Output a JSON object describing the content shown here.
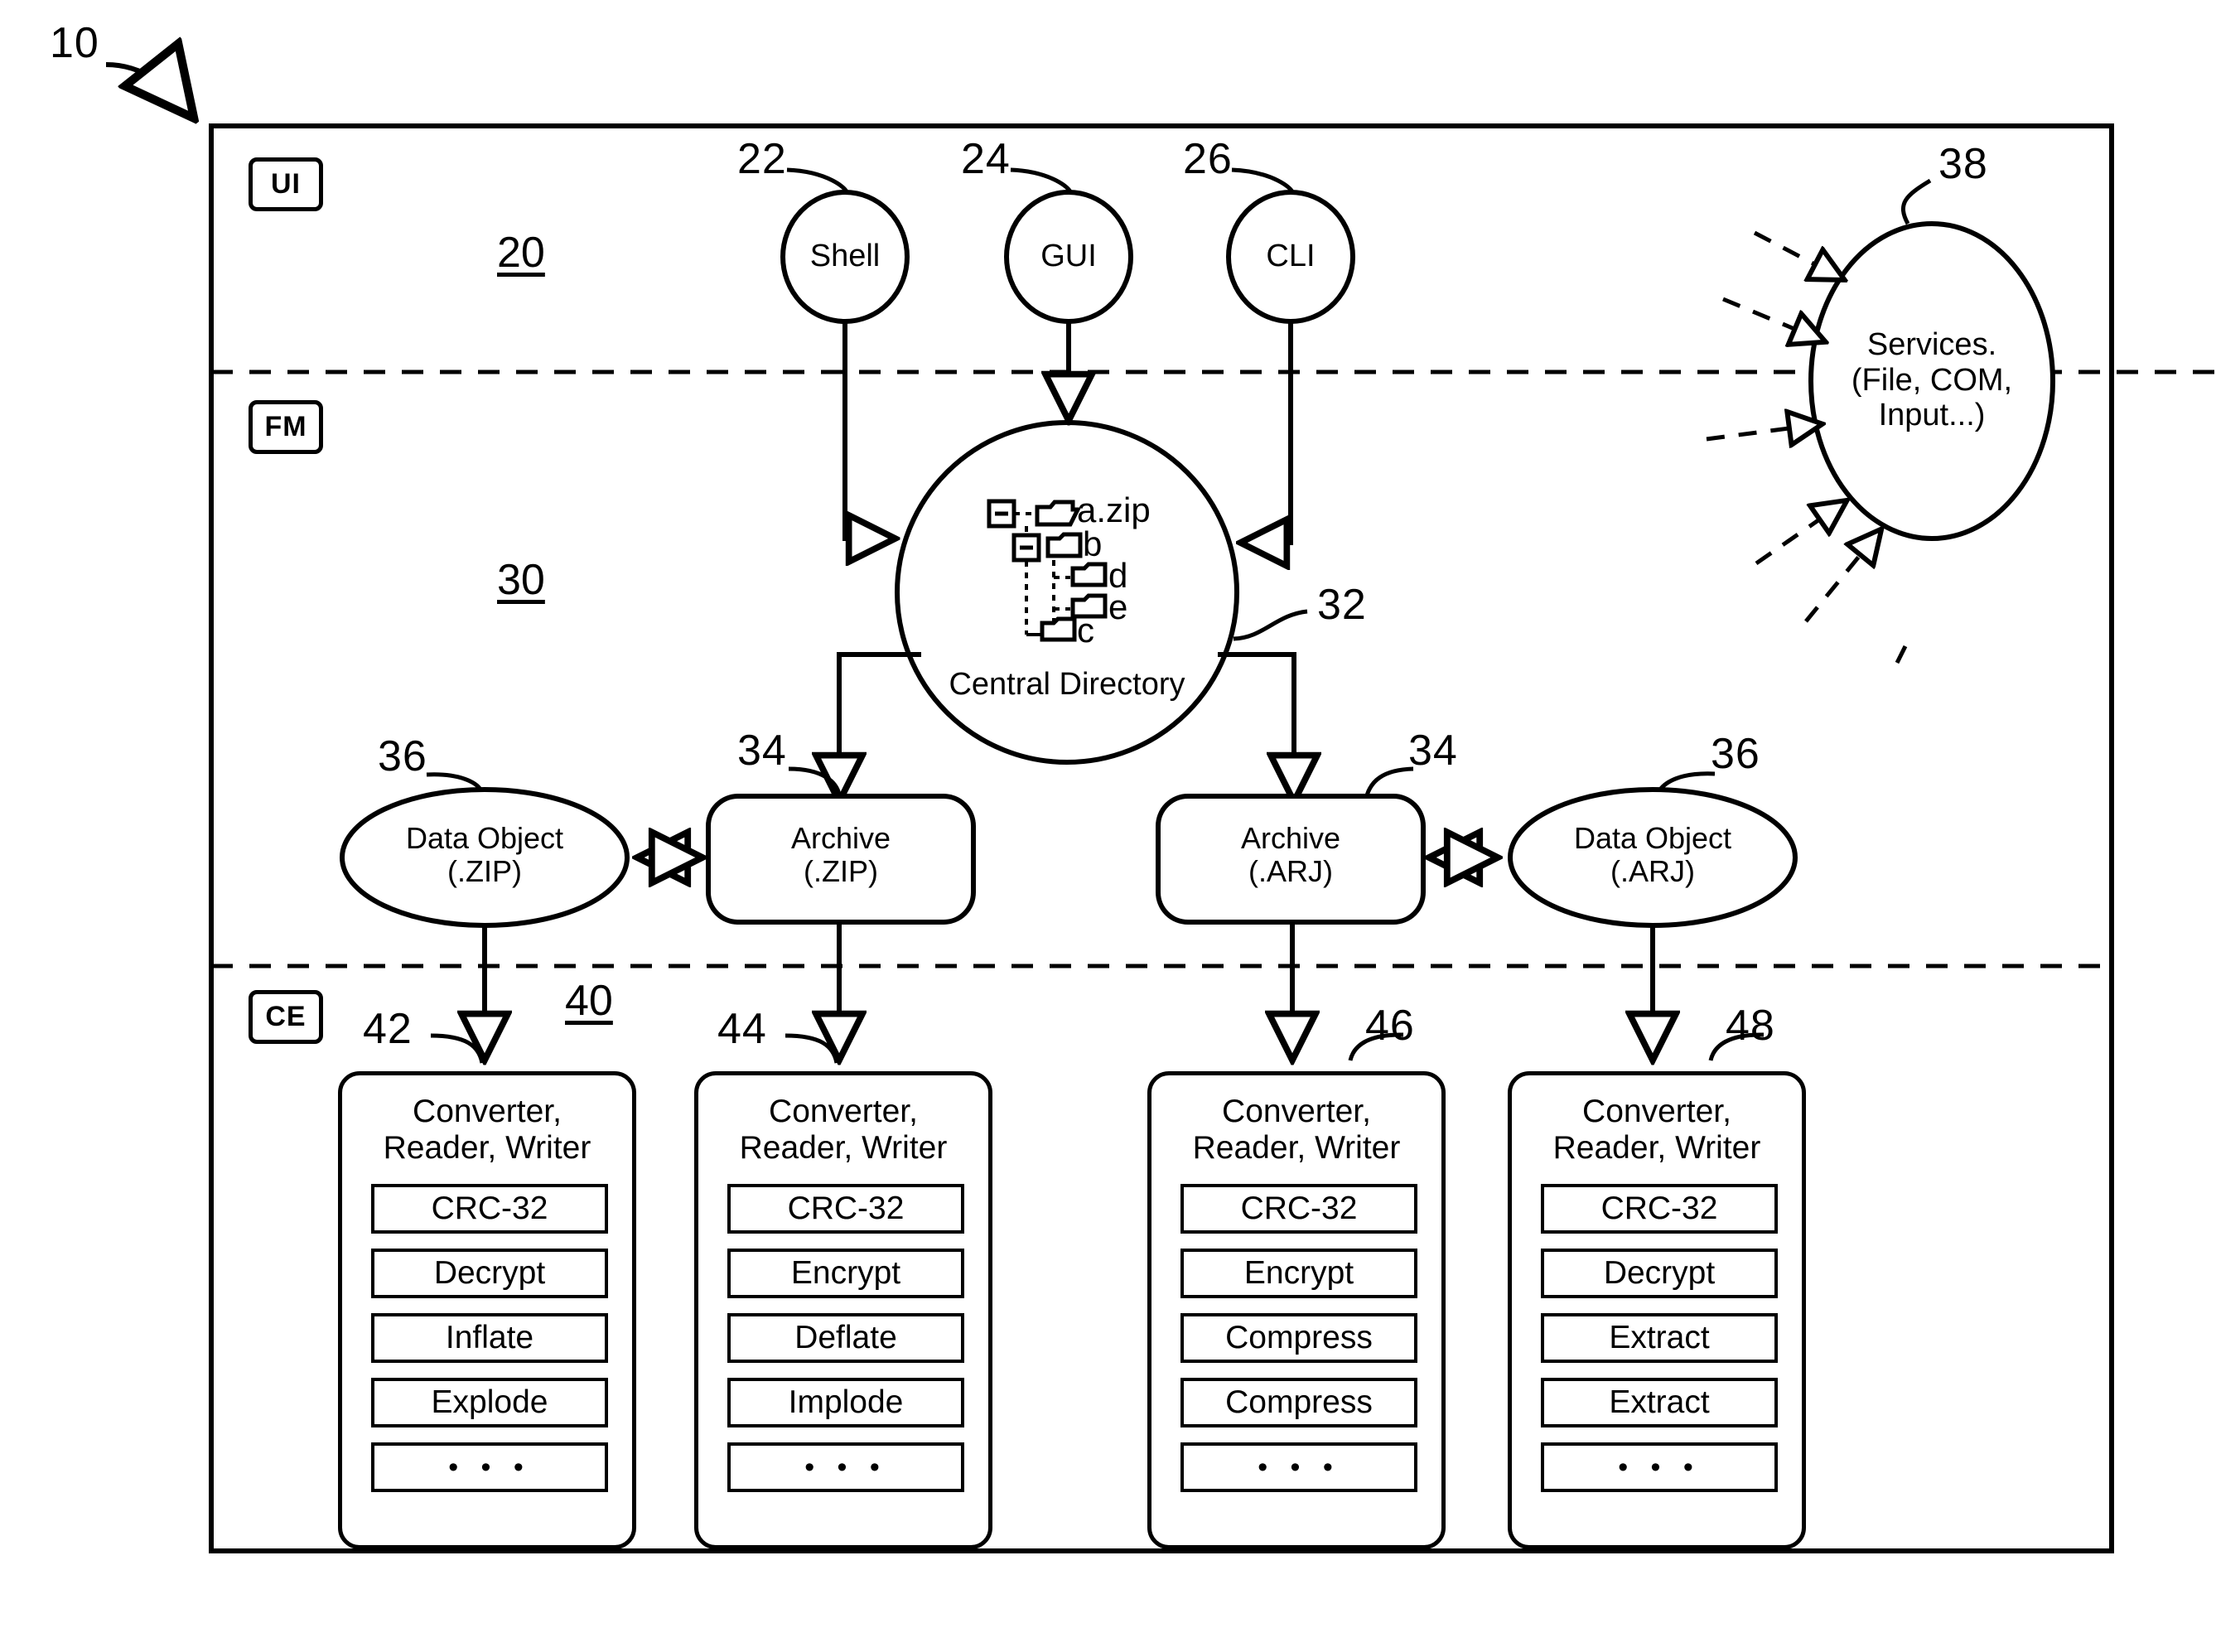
{
  "figure": {
    "main_ref": "10",
    "frame_label": "system-boundary"
  },
  "layers": [
    {
      "tag": "UI",
      "ref": "20",
      "name": "user-interface-layer"
    },
    {
      "tag": "FM",
      "ref": "30",
      "name": "file-manager-layer"
    },
    {
      "tag": "CE",
      "ref": "40",
      "name": "compression-engine-layer"
    }
  ],
  "ui_nodes": [
    {
      "label": "Shell",
      "ref": "22"
    },
    {
      "label": "GUI",
      "ref": "24"
    },
    {
      "label": "CLI",
      "ref": "26"
    }
  ],
  "central_directory": {
    "ref": "32",
    "caption": "Central Directory",
    "tree": [
      {
        "name": "a.zip",
        "depth": 0,
        "expander": "minus",
        "icon": "open-folder-icon"
      },
      {
        "name": "b",
        "depth": 1,
        "expander": "minus",
        "icon": "folder-icon"
      },
      {
        "name": "d",
        "depth": 2,
        "expander": "none",
        "icon": "folder-icon"
      },
      {
        "name": "e",
        "depth": 2,
        "expander": "none",
        "icon": "folder-icon"
      },
      {
        "name": "c",
        "depth": 1,
        "expander": "none",
        "icon": "folder-icon"
      }
    ]
  },
  "services": {
    "ref": "38",
    "lines": [
      "Services.",
      "(File, COM,",
      "Input...)"
    ],
    "incoming_arrows": 5
  },
  "middle_row": [
    {
      "ref": "36",
      "shape": "ellipse",
      "lines": [
        "Data Object",
        "(.ZIP)"
      ],
      "name": "data-object-zip"
    },
    {
      "ref": "34",
      "shape": "rounded-rect",
      "lines": [
        "Archive",
        "(.ZIP)"
      ],
      "name": "archive-zip"
    },
    {
      "ref": "34",
      "shape": "rounded-rect",
      "lines": [
        "Archive",
        "(.ARJ)"
      ],
      "name": "archive-arj"
    },
    {
      "ref": "36",
      "shape": "ellipse",
      "lines": [
        "Data Object",
        "(.ARJ)"
      ],
      "name": "data-object-arj"
    }
  ],
  "converters": [
    {
      "ref": "42",
      "title_lines": [
        "Converter,",
        "Reader, Writer"
      ],
      "slots": [
        "CRC-32",
        "Decrypt",
        "Inflate",
        "Explode",
        "• • •"
      ]
    },
    {
      "ref": "44",
      "title_lines": [
        "Converter,",
        "Reader, Writer"
      ],
      "slots": [
        "CRC-32",
        "Encrypt",
        "Deflate",
        "Implode",
        "• • •"
      ]
    },
    {
      "ref": "46",
      "title_lines": [
        "Converter,",
        "Reader, Writer"
      ],
      "slots": [
        "CRC-32",
        "Encrypt",
        "Compress",
        "Compress",
        "• • •"
      ]
    },
    {
      "ref": "48",
      "title_lines": [
        "Converter,",
        "Reader, Writer"
      ],
      "slots": [
        "CRC-32",
        "Decrypt",
        "Extract",
        "Extract",
        "• • •"
      ]
    }
  ],
  "colors": {
    "ink": "#000000",
    "paper": "#ffffff"
  }
}
